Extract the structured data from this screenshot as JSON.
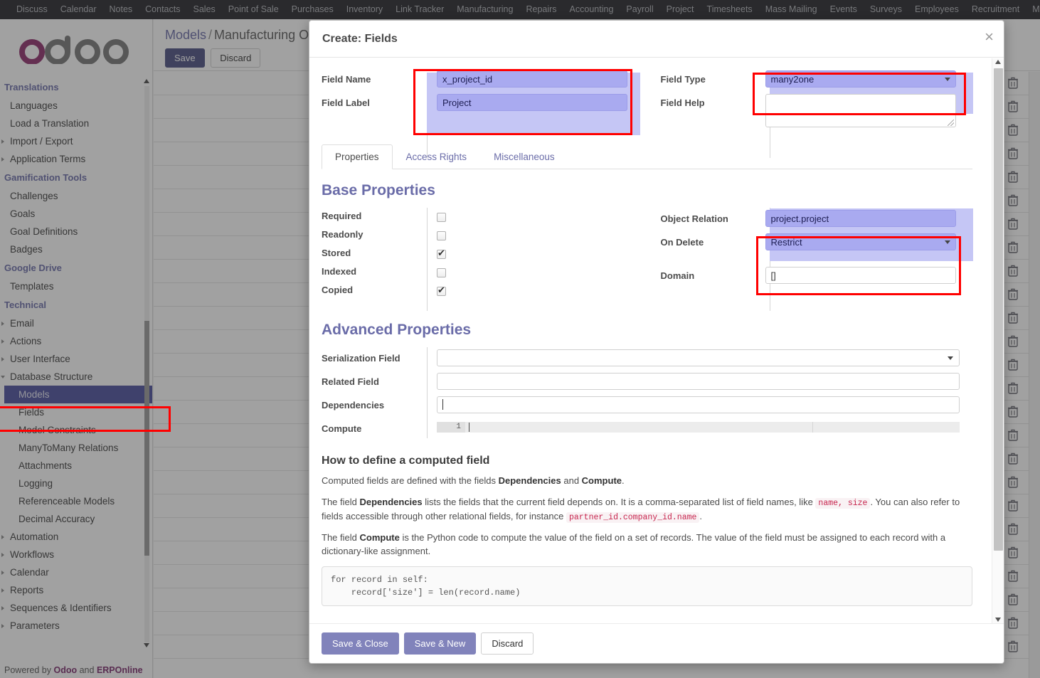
{
  "topbar": {
    "items": [
      "Discuss",
      "Calendar",
      "Notes",
      "Contacts",
      "Sales",
      "Point of Sale",
      "Purchases",
      "Inventory",
      "Link Tracker",
      "Manufacturing",
      "Repairs",
      "Accounting",
      "Payroll",
      "Project",
      "Timesheets",
      "Mass Mailing",
      "Events",
      "Surveys",
      "Employees",
      "Recruitment",
      "M"
    ]
  },
  "sidebar": {
    "logo_alt": "odoo",
    "groups": [
      {
        "title": "Translations",
        "items": [
          {
            "label": "Languages",
            "type": "leaf"
          },
          {
            "label": "Load a Translation",
            "type": "leaf"
          },
          {
            "label": "Import / Export",
            "type": "toggle"
          },
          {
            "label": "Application Terms",
            "type": "toggle"
          }
        ]
      },
      {
        "title": "Gamification Tools",
        "items": [
          {
            "label": "Challenges",
            "type": "leaf"
          },
          {
            "label": "Goals",
            "type": "leaf"
          },
          {
            "label": "Goal Definitions",
            "type": "leaf"
          },
          {
            "label": "Badges",
            "type": "leaf"
          }
        ]
      },
      {
        "title": "Google Drive",
        "items": [
          {
            "label": "Templates",
            "type": "leaf"
          }
        ]
      },
      {
        "title": "Technical",
        "items": [
          {
            "label": "Email",
            "type": "toggle"
          },
          {
            "label": "Actions",
            "type": "toggle"
          },
          {
            "label": "User Interface",
            "type": "toggle"
          },
          {
            "label": "Database Structure",
            "type": "toggle-open"
          },
          {
            "label": "Models",
            "type": "selected"
          },
          {
            "label": "Fields",
            "type": "deep"
          },
          {
            "label": "Model Constraints",
            "type": "deep"
          },
          {
            "label": "ManyToMany Relations",
            "type": "deep"
          },
          {
            "label": "Attachments",
            "type": "deep"
          },
          {
            "label": "Logging",
            "type": "deep"
          },
          {
            "label": "Referenceable Models",
            "type": "deep"
          },
          {
            "label": "Decimal Accuracy",
            "type": "deep"
          },
          {
            "label": "Automation",
            "type": "toggle"
          },
          {
            "label": "Workflows",
            "type": "toggle"
          },
          {
            "label": "Calendar",
            "type": "toggle"
          },
          {
            "label": "Reports",
            "type": "toggle"
          },
          {
            "label": "Sequences & Identifiers",
            "type": "toggle"
          },
          {
            "label": "Parameters",
            "type": "toggle"
          }
        ]
      }
    ],
    "footer_prefix": "Powered by ",
    "footer_odoo": "Odoo",
    "footer_mid": " and ",
    "footer_erp": "ERPOnline"
  },
  "content": {
    "breadcrumb_root": "Models",
    "breadcrumb_sep": "/",
    "breadcrumb_current": "Manufacturing O",
    "save_label": "Save",
    "discard_label": "Discard",
    "row_action_icon": "trash-icon",
    "row_count": 25
  },
  "dialog": {
    "title": "Create: Fields",
    "close_label": "×",
    "fields": {
      "field_name_label": "Field Name",
      "field_name_value": "x_project_id",
      "field_label_label": "Field Label",
      "field_label_value": "Project",
      "field_type_label": "Field Type",
      "field_type_value": "many2one",
      "field_help_label": "Field Help",
      "field_help_value": ""
    },
    "tabs": [
      {
        "label": "Properties",
        "active": true
      },
      {
        "label": "Access Rights",
        "active": false
      },
      {
        "label": "Miscellaneous",
        "active": false
      }
    ],
    "base_properties": {
      "title": "Base Properties",
      "checks": [
        {
          "label": "Required",
          "checked": false
        },
        {
          "label": "Readonly",
          "checked": false
        },
        {
          "label": "Stored",
          "checked": true
        },
        {
          "label": "Indexed",
          "checked": false
        },
        {
          "label": "Copied",
          "checked": true
        }
      ],
      "object_relation_label": "Object Relation",
      "object_relation_value": "project.project",
      "on_delete_label": "On Delete",
      "on_delete_value": "Restrict",
      "domain_label": "Domain",
      "domain_value": "[]"
    },
    "advanced_properties": {
      "title": "Advanced Properties",
      "serialization_field_label": "Serialization Field",
      "serialization_field_value": "",
      "related_field_label": "Related Field",
      "related_field_value": "",
      "dependencies_label": "Dependencies",
      "dependencies_value": "",
      "compute_label": "Compute",
      "compute_line_number": "1",
      "compute_value": ""
    },
    "help": {
      "heading": "How to define a computed field",
      "p1_pre": "Computed fields are defined with the fields ",
      "p1_b1": "Dependencies",
      "p1_mid": " and ",
      "p1_b2": "Compute",
      "p1_post": ".",
      "p2_pre": "The field ",
      "p2_b1": "Dependencies",
      "p2_a": " lists the fields that the current field depends on. It is a comma-separated list of field names, like ",
      "p2_code1": "name, size",
      "p2_b": ". You can also refer to fields accessible through other relational fields, for instance ",
      "p2_code2": "partner_id.company_id.name",
      "p2_c": ".",
      "p3_pre": "The field ",
      "p3_b1": "Compute",
      "p3_post": " is the Python code to compute the value of the field on a set of records. The value of the field must be assigned to each record with a dictionary-like assignment.",
      "code_block": "for record in self:\n    record['size'] = len(record.name)"
    },
    "footer": {
      "save_close_label": "Save & Close",
      "save_new_label": "Save & New",
      "discard_label": "Discard"
    }
  },
  "annotations": {
    "color": "#ff0000",
    "boxes": [
      "field-name-label-group",
      "field-type",
      "object-relation-on-delete",
      "sidebar-models"
    ]
  }
}
